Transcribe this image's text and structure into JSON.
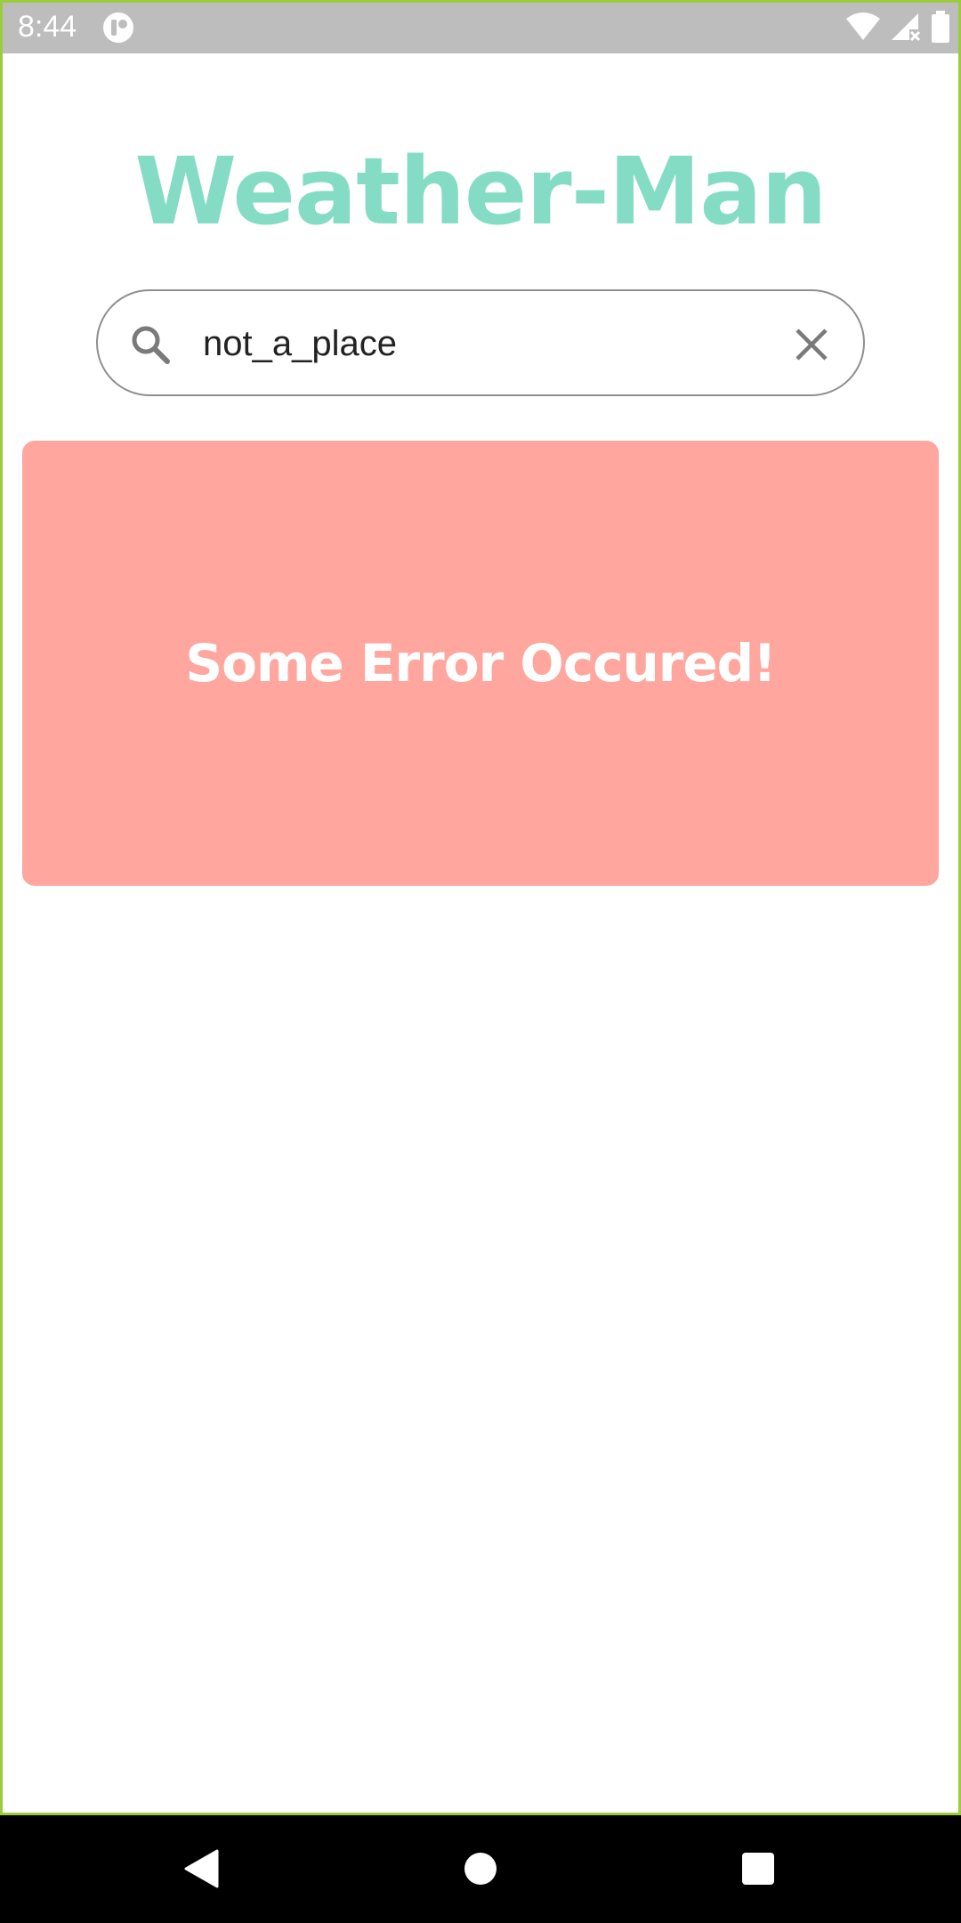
{
  "status_bar": {
    "time": "8:44",
    "app_icon": "app-notification-icon",
    "wifi_icon": "wifi-icon",
    "signal_icon": "signal-no-service-icon",
    "battery_icon": "battery-icon"
  },
  "app": {
    "title": "Weather-Man",
    "title_color": "#85dcc4"
  },
  "search": {
    "value": "not_a_place",
    "search_icon": "search-icon",
    "clear_icon": "close-icon"
  },
  "error": {
    "message": "Some Error Occured!",
    "background_color": "#ffa69f"
  },
  "nav_bar": {
    "back_icon": "back-triangle-icon",
    "home_icon": "home-circle-icon",
    "recents_icon": "recents-square-icon"
  }
}
